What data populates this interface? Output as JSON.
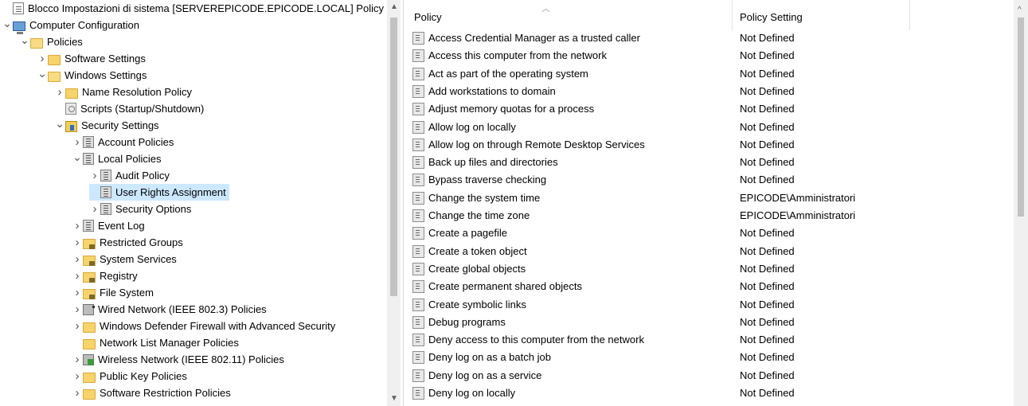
{
  "tree": {
    "items": [
      {
        "label": "Blocco Impostazioni di sistema [SERVEREPICODE.EPICODE.LOCAL] Policy",
        "indent": 0,
        "twisty": "",
        "icon": "policy-doc-icon",
        "kind": "settings-doc"
      },
      {
        "label": "Computer Configuration",
        "indent": 0,
        "twisty": "expanded",
        "icon": "computer-icon",
        "kind": "computer"
      },
      {
        "label": "Policies",
        "indent": 1,
        "twisty": "expanded",
        "icon": "folder-open-icon",
        "kind": "folder-open"
      },
      {
        "label": "Software Settings",
        "indent": 2,
        "twisty": "collapsed",
        "icon": "folder-icon",
        "kind": "folder"
      },
      {
        "label": "Windows Settings",
        "indent": 2,
        "twisty": "expanded",
        "icon": "folder-open-icon",
        "kind": "folder-open"
      },
      {
        "label": "Name Resolution Policy",
        "indent": 3,
        "twisty": "collapsed",
        "icon": "folder-icon",
        "kind": "folder"
      },
      {
        "label": "Scripts (Startup/Shutdown)",
        "indent": 3,
        "twisty": "",
        "icon": "script-icon",
        "kind": "gear-doc"
      },
      {
        "label": "Security Settings",
        "indent": 3,
        "twisty": "expanded",
        "icon": "security-settings-icon",
        "kind": "shield"
      },
      {
        "label": "Account Policies",
        "indent": 4,
        "twisty": "collapsed",
        "icon": "policy-book-icon",
        "kind": "policy-book"
      },
      {
        "label": "Local Policies",
        "indent": 4,
        "twisty": "expanded",
        "icon": "policy-book-icon",
        "kind": "policy-book"
      },
      {
        "label": "Audit Policy",
        "indent": 5,
        "twisty": "collapsed",
        "icon": "policy-book-icon",
        "kind": "policy-book"
      },
      {
        "label": "User Rights Assignment",
        "indent": 5,
        "twisty": "",
        "icon": "policy-book-icon",
        "kind": "policy-book",
        "selected": true
      },
      {
        "label": "Security Options",
        "indent": 5,
        "twisty": "collapsed",
        "icon": "policy-book-icon",
        "kind": "policy-book"
      },
      {
        "label": "Event Log",
        "indent": 4,
        "twisty": "collapsed",
        "icon": "policy-book-icon",
        "kind": "policy-book"
      },
      {
        "label": "Restricted Groups",
        "indent": 4,
        "twisty": "collapsed",
        "icon": "lock-folder-icon",
        "kind": "lock-folder"
      },
      {
        "label": "System Services",
        "indent": 4,
        "twisty": "collapsed",
        "icon": "lock-folder-icon",
        "kind": "lock-folder"
      },
      {
        "label": "Registry",
        "indent": 4,
        "twisty": "collapsed",
        "icon": "lock-folder-icon",
        "kind": "lock-folder"
      },
      {
        "label": "File System",
        "indent": 4,
        "twisty": "collapsed",
        "icon": "lock-folder-icon",
        "kind": "lock-folder"
      },
      {
        "label": "Wired Network (IEEE 802.3) Policies",
        "indent": 4,
        "twisty": "collapsed",
        "icon": "wired-network-icon",
        "kind": "network"
      },
      {
        "label": "Windows Defender Firewall with Advanced Security",
        "indent": 4,
        "twisty": "collapsed",
        "icon": "folder-icon",
        "kind": "folder"
      },
      {
        "label": "Network List Manager Policies",
        "indent": 4,
        "twisty": "",
        "icon": "folder-icon",
        "kind": "folder"
      },
      {
        "label": "Wireless Network (IEEE 802.11) Policies",
        "indent": 4,
        "twisty": "collapsed",
        "icon": "wireless-network-icon",
        "kind": "wireless"
      },
      {
        "label": "Public Key Policies",
        "indent": 4,
        "twisty": "collapsed",
        "icon": "folder-icon",
        "kind": "folder"
      },
      {
        "label": "Software Restriction Policies",
        "indent": 4,
        "twisty": "collapsed",
        "icon": "folder-icon",
        "kind": "folder"
      }
    ]
  },
  "list": {
    "columns": {
      "policy": "Policy",
      "setting": "Policy Setting"
    },
    "rows": [
      {
        "policy": "Access Credential Manager as a trusted caller",
        "setting": "Not Defined"
      },
      {
        "policy": "Access this computer from the network",
        "setting": "Not Defined"
      },
      {
        "policy": "Act as part of the operating system",
        "setting": "Not Defined"
      },
      {
        "policy": "Add workstations to domain",
        "setting": "Not Defined"
      },
      {
        "policy": "Adjust memory quotas for a process",
        "setting": "Not Defined"
      },
      {
        "policy": "Allow log on locally",
        "setting": "Not Defined"
      },
      {
        "policy": "Allow log on through Remote Desktop Services",
        "setting": "Not Defined"
      },
      {
        "policy": "Back up files and directories",
        "setting": "Not Defined"
      },
      {
        "policy": "Bypass traverse checking",
        "setting": "Not Defined"
      },
      {
        "policy": "Change the system time",
        "setting": "EPICODE\\Amministratori"
      },
      {
        "policy": "Change the time zone",
        "setting": "EPICODE\\Amministratori"
      },
      {
        "policy": "Create a pagefile",
        "setting": "Not Defined"
      },
      {
        "policy": "Create a token object",
        "setting": "Not Defined"
      },
      {
        "policy": "Create global objects",
        "setting": "Not Defined"
      },
      {
        "policy": "Create permanent shared objects",
        "setting": "Not Defined"
      },
      {
        "policy": "Create symbolic links",
        "setting": "Not Defined"
      },
      {
        "policy": "Debug programs",
        "setting": "Not Defined"
      },
      {
        "policy": "Deny access to this computer from the network",
        "setting": "Not Defined"
      },
      {
        "policy": "Deny log on as a batch job",
        "setting": "Not Defined"
      },
      {
        "policy": "Deny log on as a service",
        "setting": "Not Defined"
      },
      {
        "policy": "Deny log on locally",
        "setting": "Not Defined"
      }
    ]
  },
  "colors": {
    "selection": "#cce8ff",
    "scroll_thumb": "#c2c2c2"
  }
}
